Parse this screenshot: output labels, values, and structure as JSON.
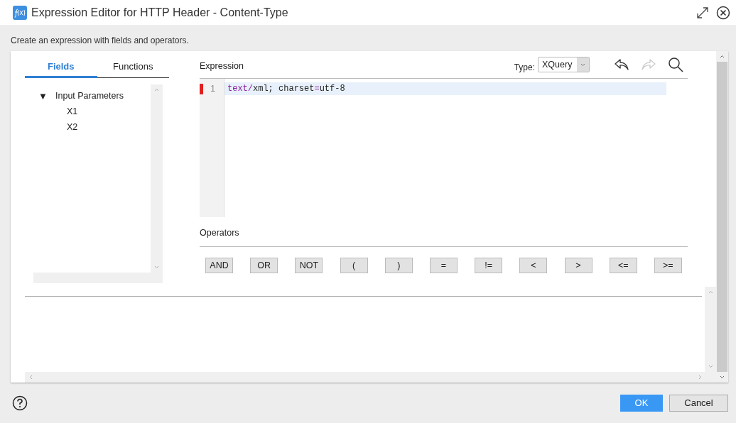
{
  "window": {
    "title": "Expression Editor for HTTP Header - Content-Type"
  },
  "instruction": "Create an expression with fields and operators.",
  "tabs": [
    {
      "label": "Fields",
      "selected": true
    },
    {
      "label": "Functions",
      "selected": false
    }
  ],
  "tree": [
    {
      "label": "Input Parameters",
      "expanded": true,
      "toggle": "▼",
      "children": [
        {
          "label": "X1"
        },
        {
          "label": "X2"
        }
      ]
    }
  ],
  "expression": {
    "label": "Expression",
    "type_label": "Type:",
    "type_value": "XQuery",
    "lines": [
      {
        "number": "1",
        "error": true,
        "current": true,
        "tokens": [
          {
            "text": "text/",
            "kind": "keyword"
          },
          {
            "text": "xml; charset",
            "kind": "plain"
          },
          {
            "text": "=",
            "kind": "keyword"
          },
          {
            "text": "utf-8",
            "kind": "plain"
          }
        ]
      }
    ]
  },
  "undo": {
    "disabled": false
  },
  "redo": {
    "disabled": true
  },
  "operators": {
    "label": "Operators",
    "buttons": [
      "AND",
      "OR",
      "NOT",
      "(",
      ")",
      "=",
      "!=",
      "<",
      ">",
      "<=",
      ">="
    ]
  },
  "buttons": {
    "ok": "OK",
    "cancel": "Cancel"
  }
}
